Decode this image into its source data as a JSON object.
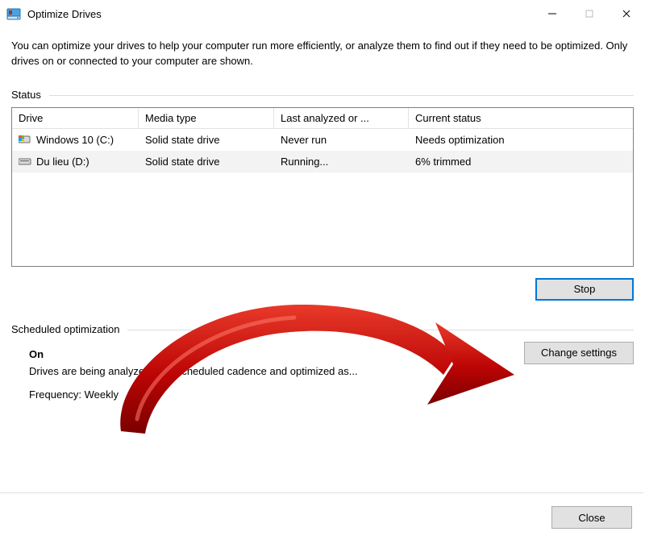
{
  "window": {
    "title": "Optimize Drives"
  },
  "intro_text": "You can optimize your drives to help your computer run more efficiently, or analyze them to find out if they need to be optimized. Only drives on or connected to your computer are shown.",
  "status_section_label": "Status",
  "drives_table": {
    "headers": {
      "drive": "Drive",
      "media": "Media type",
      "last": "Last analyzed or ...",
      "status": "Current status"
    },
    "rows": [
      {
        "name": "Windows 10 (C:)",
        "media": "Solid state drive",
        "last": "Never run",
        "status": "Needs optimization",
        "icon": "drive-win"
      },
      {
        "name": "Du lieu (D:)",
        "media": "Solid state drive",
        "last": "Running...",
        "status": "6% trimmed",
        "icon": "drive-ssd"
      }
    ]
  },
  "stop_button_label": "Stop",
  "scheduled_section_label": "Scheduled optimization",
  "scheduled": {
    "state": "On",
    "description": "Drives are being analyzed on a scheduled cadence and optimized as...",
    "frequency_label": "Frequency: Weekly"
  },
  "change_settings_label": "Change settings",
  "close_label": "Close"
}
